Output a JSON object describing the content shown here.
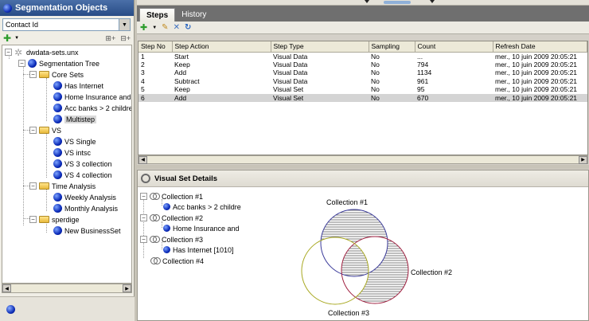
{
  "left_panel": {
    "title": "Segmentation Objects",
    "selector": {
      "value": "Contact Id"
    },
    "tree": {
      "root": "dwdata-sets.unx",
      "segmentation_tree": "Segmentation Tree",
      "folders": {
        "core_sets": {
          "label": "Core Sets",
          "items": [
            "Has Internet",
            "Home Insurance and",
            "Acc banks > 2 childre",
            "Multistep"
          ]
        },
        "vs": {
          "label": "VS",
          "items": [
            "VS Single",
            "VS intsc",
            "VS 3 collection",
            "VS 4 collection"
          ]
        },
        "time_analysis": {
          "label": "Time Analysis",
          "items": [
            "Weekly Analysis",
            "Monthly Analysis"
          ]
        },
        "sperdige": {
          "label": "sperdige",
          "items": [
            "New BusinessSet"
          ]
        }
      }
    }
  },
  "tabs": [
    {
      "label": "Steps"
    },
    {
      "label": "History"
    }
  ],
  "steps_table": {
    "headers": [
      "Step No",
      "Step Action",
      "Step Type",
      "Sampling",
      "Count",
      "Refresh Date"
    ],
    "rows": [
      [
        "1",
        "Start",
        "Visual Data",
        "No",
        "...",
        "mer., 10 juin 2009 20:05:21"
      ],
      [
        "2",
        "Keep",
        "Visual Data",
        "No",
        "794",
        "mer., 10 juin 2009 20:05:21"
      ],
      [
        "3",
        "Add",
        "Visual Data",
        "No",
        "1134",
        "mer., 10 juin 2009 20:05:21"
      ],
      [
        "4",
        "Subtract",
        "Visual Data",
        "No",
        "961",
        "mer., 10 juin 2009 20:05:21"
      ],
      [
        "5",
        "Keep",
        "Visual Set",
        "No",
        "95",
        "mer., 10 juin 2009 20:05:21"
      ],
      [
        "6",
        "Add",
        "Visual Set",
        "No",
        "670",
        "mer., 10 juin 2009 20:05:21"
      ]
    ],
    "selected_row": 6
  },
  "visual_set_details": {
    "title": "Visual Set Details",
    "collections": [
      {
        "label": "Collection #1",
        "child": "Acc banks > 2 childre"
      },
      {
        "label": "Collection #2",
        "child": "Home Insurance and"
      },
      {
        "label": "Collection #3",
        "child": "Has Internet [1010]"
      },
      {
        "label": "Collection #4",
        "child": ""
      }
    ],
    "venn": {
      "labels": [
        "Collection #1",
        "Collection #2",
        "Collection #3"
      ],
      "colors": {
        "c1": "#3a3a9a",
        "c2": "#a02040",
        "c3": "#a8a820"
      }
    }
  },
  "colors": {
    "header_bg": "#284c86",
    "tab_bar": "#6f6f6f",
    "selection": "#d4d4d4"
  }
}
